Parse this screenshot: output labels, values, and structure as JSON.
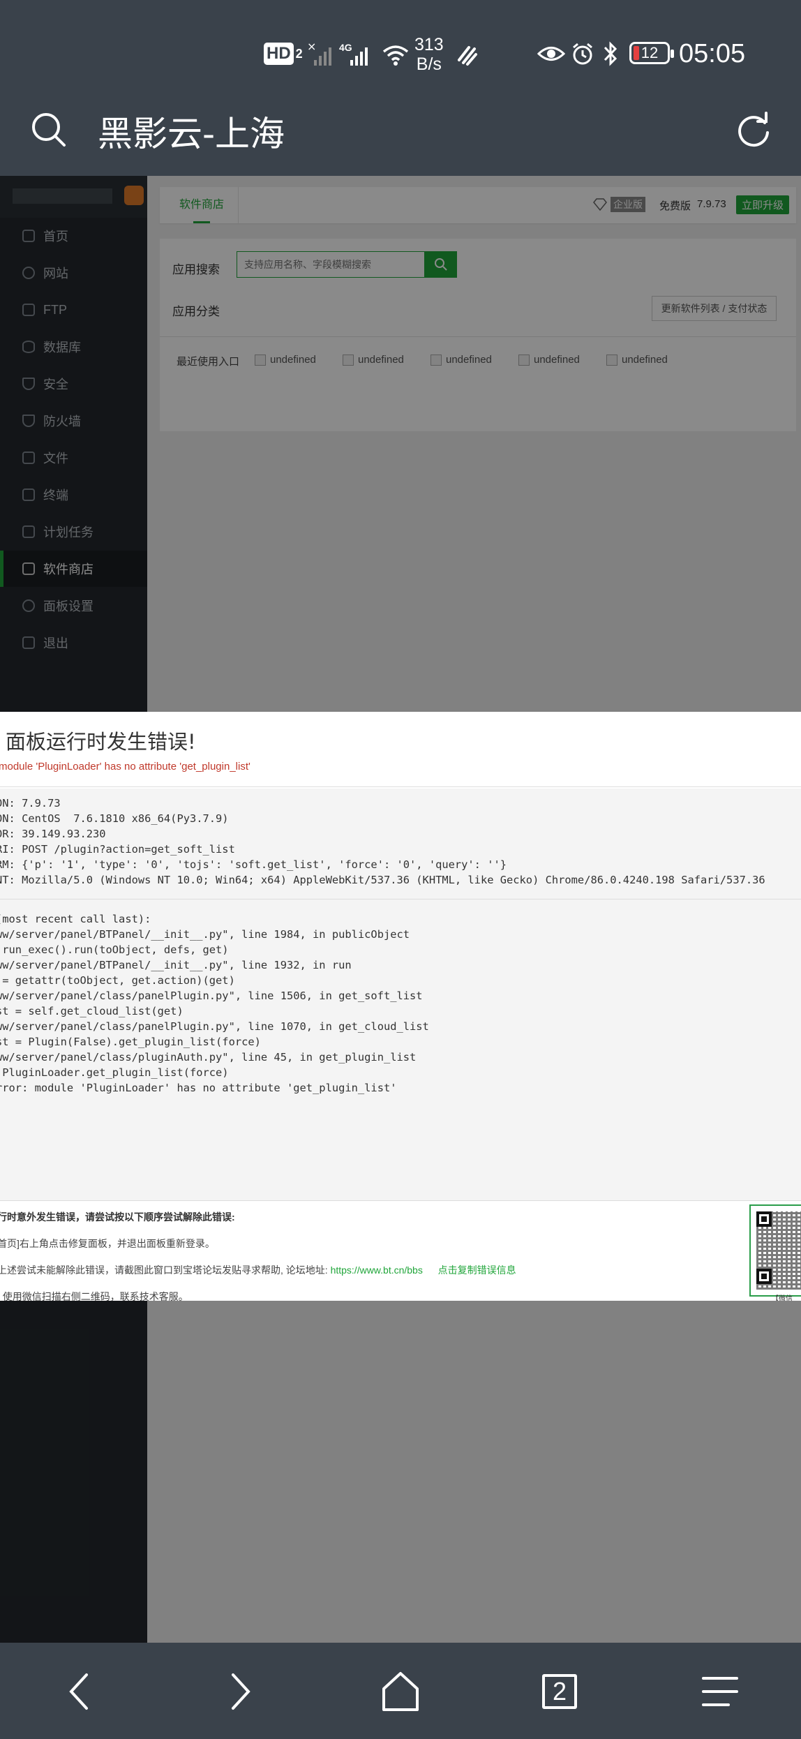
{
  "status_bar": {
    "hd": "HD",
    "hd_sub": "2",
    "net_type": "4G",
    "speed_value": "313",
    "speed_unit": "B/s",
    "battery": "12",
    "time": "05:05"
  },
  "browser": {
    "title": "黑影云-上海",
    "tabs_count": "2"
  },
  "sidebar": {
    "items": [
      {
        "label": "首页"
      },
      {
        "label": "网站"
      },
      {
        "label": "FTP"
      },
      {
        "label": "数据库"
      },
      {
        "label": "安全"
      },
      {
        "label": "防火墙"
      },
      {
        "label": "文件"
      },
      {
        "label": "终端"
      },
      {
        "label": "计划任务"
      },
      {
        "label": "软件商店",
        "active": true
      },
      {
        "label": "面板设置"
      },
      {
        "label": "退出"
      }
    ]
  },
  "topbar": {
    "tab": "软件商店",
    "enterprise": "企业版",
    "free": "免费版",
    "version": "7.9.73",
    "upgrade": "立即升级"
  },
  "store": {
    "search_label": "应用搜索",
    "search_placeholder": "支持应用名称、字段模糊搜索",
    "category_label": "应用分类",
    "update_button": "更新软件列表 / 支付状态",
    "recent_label": "最近使用入口",
    "recent_items": [
      "undefined",
      "undefined",
      "undefined",
      "undefined",
      "undefined"
    ]
  },
  "error_dialog": {
    "title": "面板运行时发生错误!",
    "error_summary": "module 'PluginLoader' has no attribute 'get_plugin_list'",
    "info_lines": [
      "ON: 7.9.73",
      "ON: CentOS  7.6.1810 x86_64(Py3.7.9)",
      "OR: 39.149.93.230",
      "RI: POST /plugin?action=get_soft_list",
      "RM: {'p': '1', 'type': '0', 'tojs': 'soft.get_list', 'force': '0', 'query': ''}",
      "NT: Mozilla/5.0 (Windows NT 10.0; Win64; x64) AppleWebKit/537.36 (KHTML, like Gecko) Chrome/86.0.4240.198 Safari/537.36"
    ],
    "traceback_lines": [
      "(most recent call last):",
      "ww/server/panel/BTPanel/__init__.py\", line 1984, in publicObject",
      " run_exec().run(toObject, defs, get)",
      "ww/server/panel/BTPanel/__init__.py\", line 1932, in run",
      " = getattr(toObject, get.action)(get)",
      "ww/server/panel/class/panelPlugin.py\", line 1506, in get_soft_list",
      "st = self.get_cloud_list(get)",
      "ww/server/panel/class/panelPlugin.py\", line 1070, in get_cloud_list",
      "st = Plugin(False).get_plugin_list(force)",
      "ww/server/panel/class/pluginAuth.py\", line 45, in get_plugin_list",
      " PluginLoader.get_plugin_list(force)",
      "rror: module 'PluginLoader' has no attribute 'get_plugin_list'"
    ],
    "help_heading": "行时意外发生错误，请尝试按以下顺序尝试解除此错误:",
    "help_line1": "首页]右上角点击修复面板，并退出面板重新登录。",
    "help_line2": "上述尝试未能解除此错误，请截图此窗口到宝塔论坛发贴寻求帮助, 论坛地址:",
    "forum_link": "https://www.bt.cn/bbs",
    "copy_link": "点击复制错误信息",
    "help_line3": ": 使用微信扫描右侧二维码，联系技术客服。",
    "qr_caption": "【微信"
  },
  "colors": {
    "brand_green": "#20a53a",
    "error_red": "#c0392b",
    "chrome_bg": "#3a424b"
  }
}
